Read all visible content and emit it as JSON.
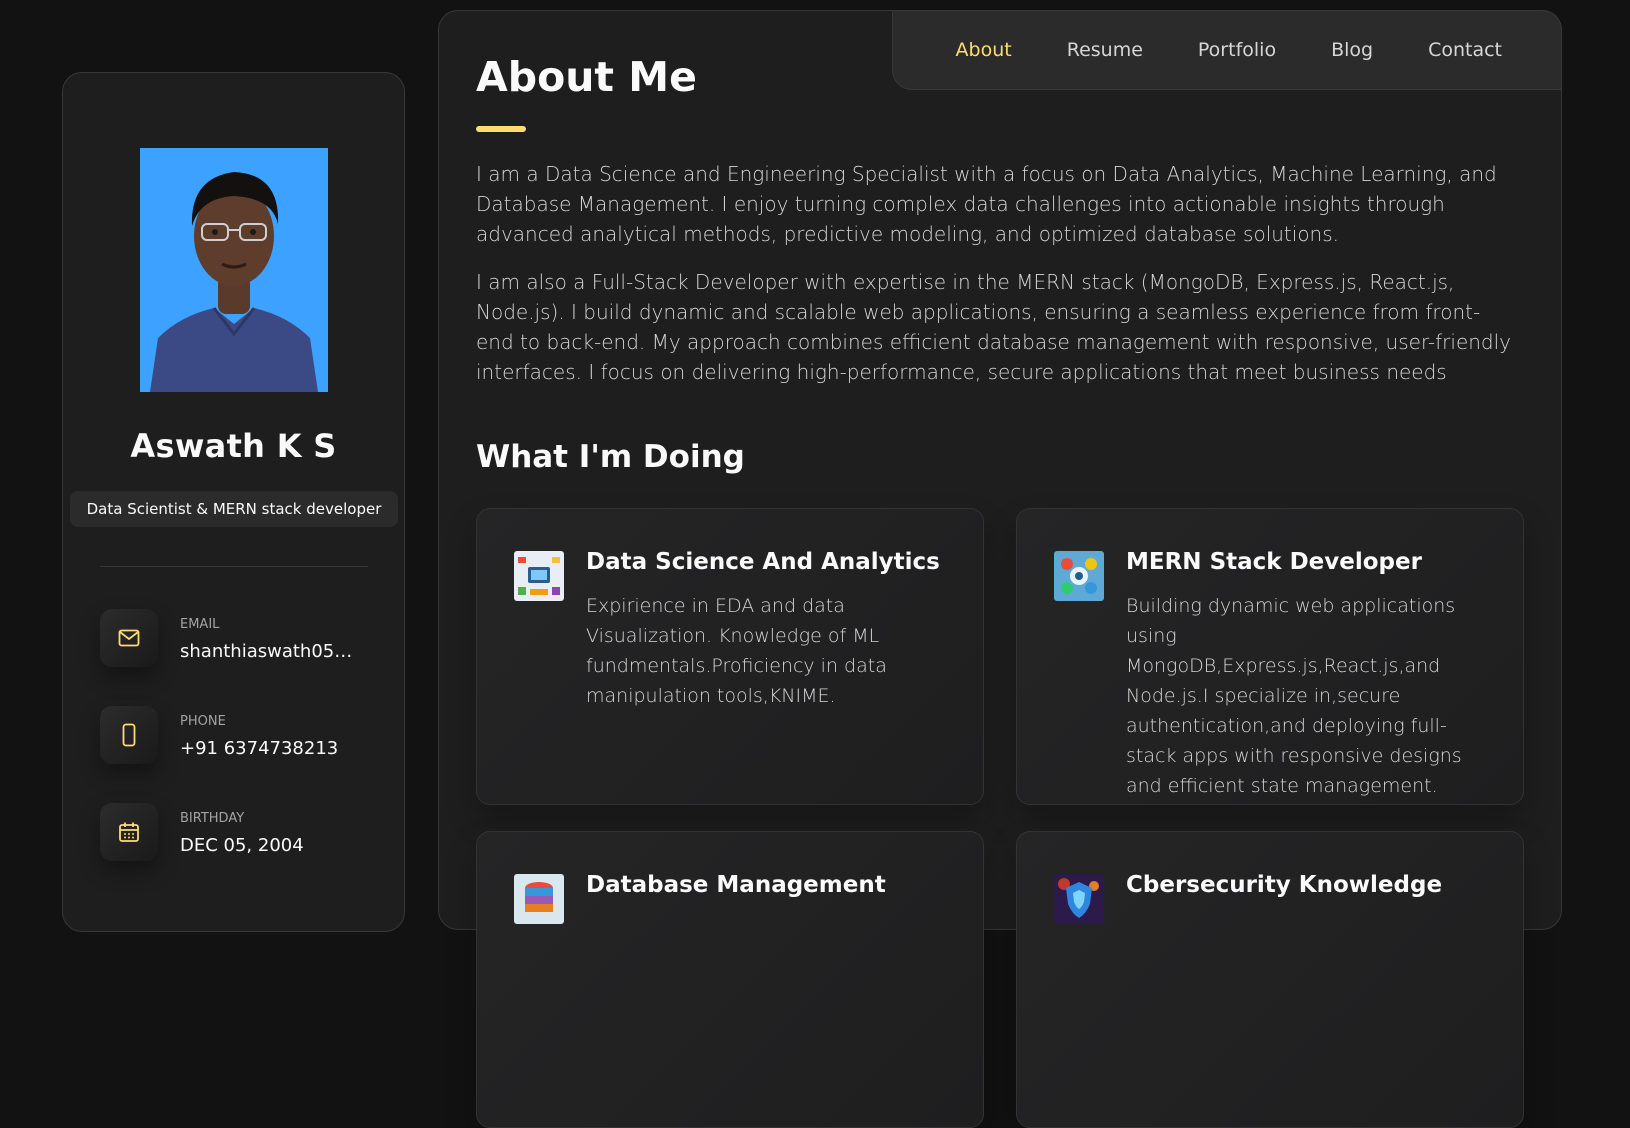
{
  "profile": {
    "name": "Aswath K S",
    "title": "Data Scientist & MERN stack developer",
    "contacts": [
      {
        "label": "EMAIL",
        "value": "shanthiaswath05@...",
        "icon": "mail-icon"
      },
      {
        "label": "PHONE",
        "value": "+91 6374738213",
        "icon": "phone-icon"
      },
      {
        "label": "BIRTHDAY",
        "value": "DEC 05, 2004",
        "icon": "calendar-icon"
      }
    ]
  },
  "nav": {
    "items": [
      "About",
      "Resume",
      "Portfolio",
      "Blog",
      "Contact"
    ],
    "active": "About"
  },
  "about": {
    "heading": "About Me",
    "paragraphs": [
      "I am a Data Science and Engineering Specialist with a focus on Data Analytics, Machine Learning, and Database Management. I enjoy turning complex data challenges into actionable insights through advanced analytical methods, predictive modeling, and optimized database solutions.",
      "I am also a Full-Stack Developer with expertise in the MERN stack (MongoDB, Express.js, React.js, Node.js). I build dynamic and scalable web applications, ensuring a seamless experience from front-end to back-end. My approach combines efficient database management with responsive, user-friendly interfaces. I focus on delivering high-performance, secure applications that meet business needs"
    ]
  },
  "services": {
    "heading": "What I'm Doing",
    "items": [
      {
        "title": "Data Science And Analytics",
        "text": "Expirience in EDA and data Visualization. Knowledge of ML fundmentals.Proficiency in data manipulation tools,KNIME."
      },
      {
        "title": "MERN Stack Developer",
        "text": "Building dynamic web applications using MongoDB,Express.js,React.js,and Node.js.I specialize in,secure authentication,and deploying full-stack apps with responsive designs and efficient state management."
      },
      {
        "title": "Database Management",
        "text": ""
      },
      {
        "title": "Cbersecurity Knowledge",
        "text": ""
      }
    ]
  },
  "colors": {
    "accent": "#ffdb70",
    "background": "#121212",
    "panel": "#1e1e1f"
  }
}
